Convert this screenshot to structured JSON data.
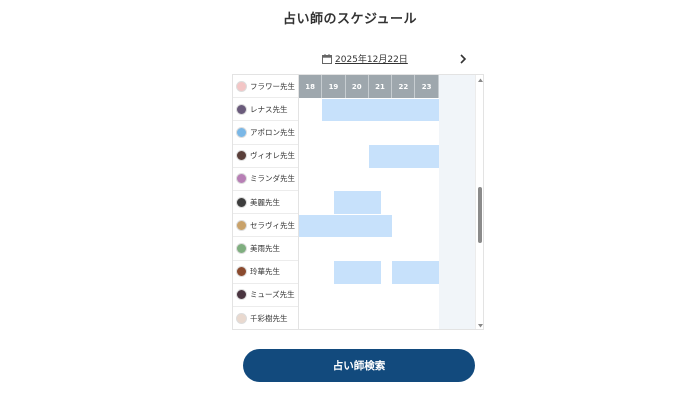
{
  "header": {
    "title": "占い師のスケジュール"
  },
  "date_nav": {
    "date_label": "2025年12月22日",
    "calendar_icon": "calendar-icon",
    "next_icon": "chevron-right-icon"
  },
  "schedule": {
    "hours": [
      "18",
      "19",
      "20",
      "21",
      "22",
      "23"
    ],
    "fortune_tellers": [
      {
        "name": "フラワー先生",
        "avatar_color": "#f3c6c6"
      },
      {
        "name": "レナス先生",
        "avatar_color": "#6a5b7b"
      },
      {
        "name": "アポロン先生",
        "avatar_color": "#7ab7e6"
      },
      {
        "name": "ヴィオレ先生",
        "avatar_color": "#5a3f3a"
      },
      {
        "name": "ミランダ先生",
        "avatar_color": "#b77fb5"
      },
      {
        "name": "美麗先生",
        "avatar_color": "#3d3d3d"
      },
      {
        "name": "セラヴィ先生",
        "avatar_color": "#c9a26a"
      },
      {
        "name": "美雨先生",
        "avatar_color": "#7fae7f"
      },
      {
        "name": "玲華先生",
        "avatar_color": "#8a4a2e"
      },
      {
        "name": "ミューズ先生",
        "avatar_color": "#4a3540"
      },
      {
        "name": "千彩樹先生",
        "avatar_color": "#e9d9cf"
      }
    ],
    "available_color": "#c7e1fb"
  },
  "footer": {
    "search_button_label": "占い師検索"
  },
  "colors": {
    "header_bg": "#9ea7ad",
    "button_bg": "#124a7d"
  }
}
